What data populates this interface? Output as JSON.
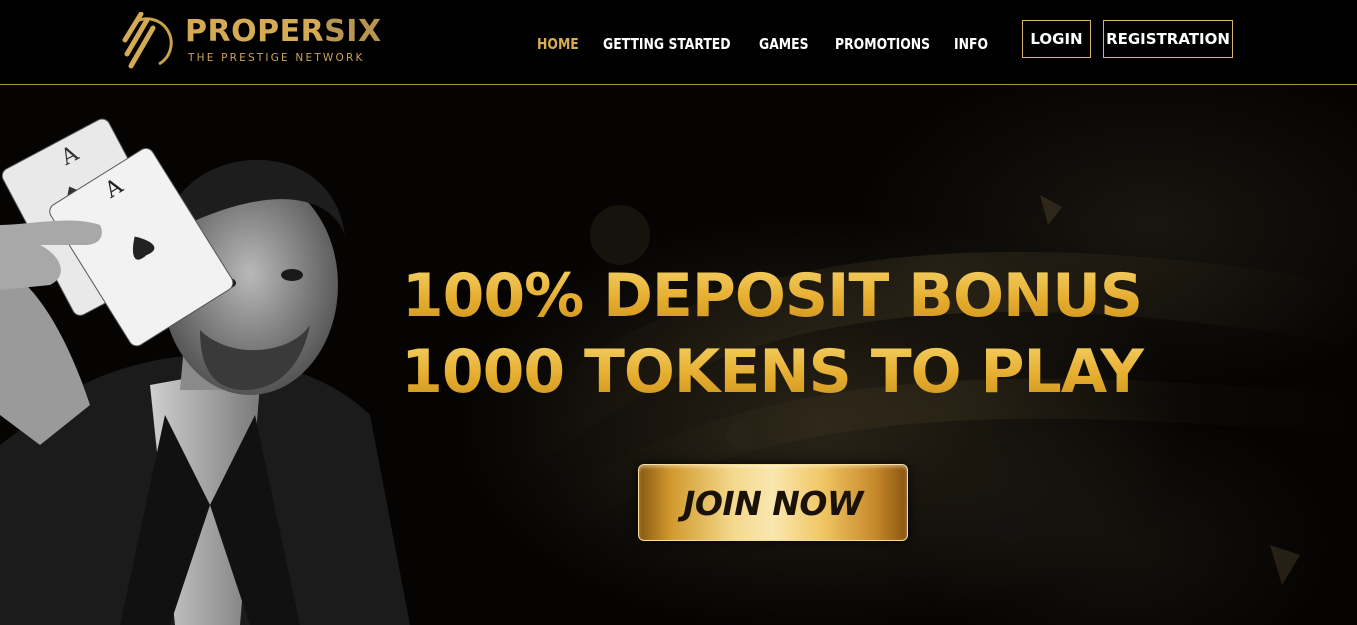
{
  "brand": {
    "name_part1": "PROPER",
    "name_part2": "SIX",
    "tagline": "THE PRESTIGE NETWORK",
    "logo_icon": "stripes-ring-logo-icon",
    "accent_color": "#d4aa55"
  },
  "nav": {
    "items": [
      {
        "label": "HOME",
        "active": true
      },
      {
        "label": "GETTING STARTED",
        "active": false
      },
      {
        "label": "GAMES",
        "active": false
      },
      {
        "label": "PROMOTIONS",
        "active": false
      },
      {
        "label": "INFO",
        "active": false
      }
    ],
    "login_label": "LOGIN",
    "registration_label": "REGISTRATION"
  },
  "hero": {
    "headline_line1": "100% DEPOSIT BONUS",
    "headline_line2": "1000 TOKENS TO PLAY",
    "cta_label": "JOIN NOW",
    "card_rank": "A",
    "headline_color": "#e8b93c"
  }
}
